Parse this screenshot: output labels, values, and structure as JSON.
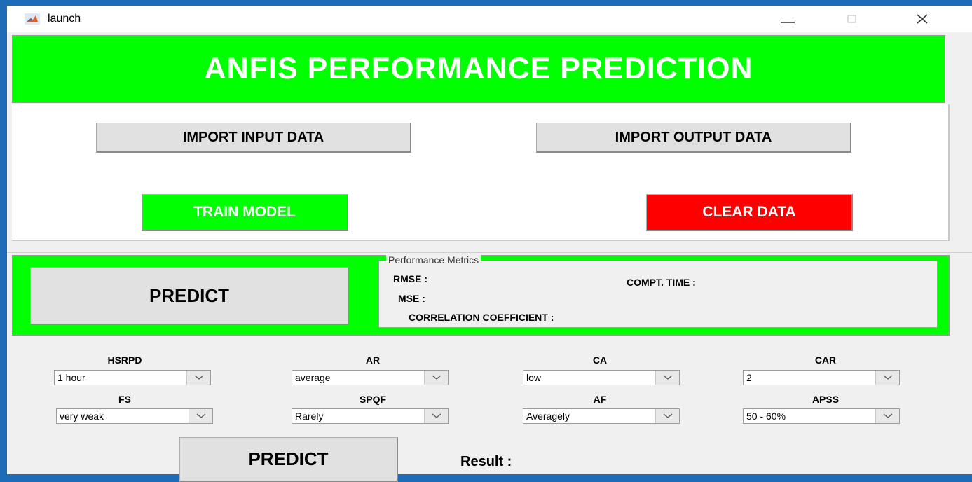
{
  "window": {
    "title": "launch"
  },
  "banner": {
    "text": "ANFIS PERFORMANCE PREDICTION"
  },
  "buttons": {
    "import_input": "IMPORT INPUT DATA",
    "import_output": "IMPORT OUTPUT DATA",
    "train_model": "TRAIN MODEL",
    "clear_data": "CLEAR DATA",
    "predict_top": "PREDICT",
    "predict_bottom": "PREDICT"
  },
  "metrics": {
    "title": "Performance Metrics",
    "rmse": "RMSE :",
    "mse": "MSE :",
    "compt_time": "COMPT. TIME :",
    "correlation": "CORRELATION COEFFICIENT :"
  },
  "dropdowns": [
    {
      "label": "HSRPD",
      "value": "1 hour"
    },
    {
      "label": "AR",
      "value": "average"
    },
    {
      "label": "CA",
      "value": "low"
    },
    {
      "label": "CAR",
      "value": "2"
    },
    {
      "label": "FS",
      "value": "very weak"
    },
    {
      "label": "SPQF",
      "value": "Rarely"
    },
    {
      "label": "AF",
      "value": "Averagely"
    },
    {
      "label": "APSS",
      "value": "50 - 60%"
    }
  ],
  "result": {
    "label": "Result :"
  },
  "colors": {
    "banner": "#00ff00",
    "train": "#00ff00",
    "clear": "#ff0000",
    "panel": "#00ff00"
  }
}
